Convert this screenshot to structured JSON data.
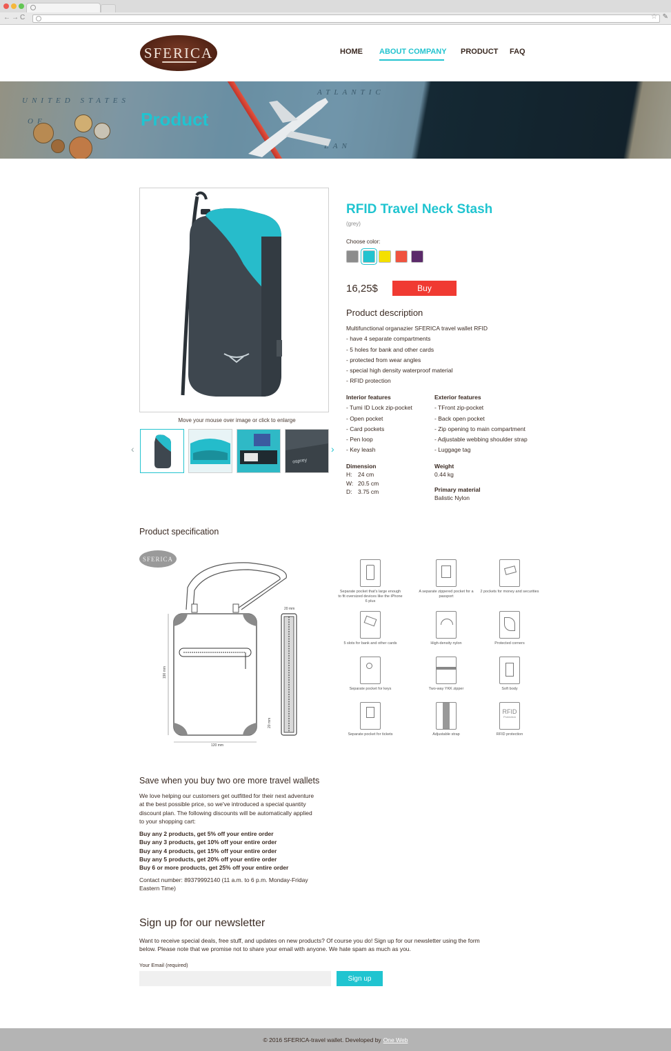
{
  "browser": {
    "window_buttons": [
      "close",
      "minimize",
      "maximize"
    ]
  },
  "header": {
    "logo_text": "SFERICA",
    "nav": [
      {
        "label": "HOME"
      },
      {
        "label": "ABOUT COMPANY",
        "active": true
      },
      {
        "label": "PRODUCT"
      },
      {
        "label": "FAQ"
      }
    ]
  },
  "banner": {
    "title": "Product",
    "map_words": [
      "UNITED STATES",
      "OF",
      "ATLANTIC",
      "EAN"
    ]
  },
  "gallery": {
    "zoom_hint": "Move your mouse over image or click to enlarge",
    "thumbnail_count": 4,
    "thumb_text": "osprey"
  },
  "product": {
    "title": "RFID Travel Neck Stash",
    "variant": "(grey)",
    "choose_color_label": "Choose color:",
    "colors": [
      "#8c8c8c",
      "#22c3cf",
      "#f4e000",
      "#f0533f",
      "#5b2a6a"
    ],
    "selected_color": 1,
    "price": "16,25$",
    "buy_label": "Buy",
    "description_title": "Product description",
    "description_lines": [
      "Multifunctional organazier SFERICA travel wallet RFID",
      "- have 4 separate compartments",
      "- 5 holes for bank and other cards",
      "- protected from wear angles",
      "- special high density waterproof material",
      "- RFID protection"
    ],
    "interior": {
      "title": "Interior features",
      "items": [
        "- Tumi ID Lock zip-pocket",
        "- Open pocket",
        "- Card pockets",
        "- Pen loop",
        "- Key leash"
      ]
    },
    "exterior": {
      "title": "Exterior features",
      "items": [
        "- TFront zip-pocket",
        "- Back open pocket",
        "- Zip opening to main compartment",
        "- Adjustable webbing shoulder strap",
        "- Luggage tag"
      ]
    },
    "dimension": {
      "title": "Dimension",
      "h_label": "H:",
      "h": "24 cm",
      "w_label": "W:",
      "w": "20.5 cm",
      "d_label": "D:",
      "d": "3.75 cm"
    },
    "weight": {
      "title": "Weight",
      "value": "0.44 kg"
    },
    "material": {
      "title": "Primary material",
      "value": "Balistic Nylon"
    }
  },
  "spec": {
    "title": "Product specification",
    "logo_text": "SFERICA",
    "drawing_labels": {
      "width": "120 mm",
      "height": "190 mm",
      "depth": "20 mm",
      "side": "20 mm"
    },
    "features": [
      "Separate pocket that's large enough to fit oversized devices like the iPhone 6 plus",
      "A separate zippered pocket for a passport",
      "2 pockets for money and securities",
      "5 slots for bank and other cards",
      "High-density nylon",
      "Protected corners",
      "Separate pocket for keys",
      "Two-way YKK zipper",
      "Soft body",
      "Separate pocket  for tickets",
      "Adjustable strap",
      "RFID protection"
    ],
    "rfid_icon_text": "RFID",
    "rfid_icon_sub": "Protection"
  },
  "discount": {
    "title": "Save when you buy two ore more travel wallets",
    "intro_lines": [
      "We love helping our customers get outfitted for their next adventure",
      "at the best possible price, so we've introduced a special quantity",
      "discount plan. The following discounts will be automatically applied",
      "to your shopping cart:"
    ],
    "tiers": [
      "Buy any 2 products, get 5% off your entire order",
      "Buy any 3 products, get 10% off your entire order",
      "Buy any 4 products, get 15% off your entire order",
      "Buy any 5 products, get 20% off your entire order",
      "Buy 6 or more products, get 25% off your entire order"
    ],
    "contact_lines": [
      "Contact number: 89379992140 (11 a.m. to 6 p.m. Monday-Friday",
      "Eastern Time)"
    ]
  },
  "newsletter": {
    "title": "Sign up for our newsletter",
    "text_lines": [
      "Want to receive special deals, free stuff, and updates on new products? Of course you do! Sign up for our newsletter using the form",
      "below. Please note that we promise not to share your email with anyone. We hate spam as much as you."
    ],
    "email_label": "Your Email (required)",
    "email_value": "",
    "button_label": "Sign up"
  },
  "footer": {
    "text": "© 2016 SFERICA-travel wallet. Developed by",
    "link": "One Web"
  }
}
